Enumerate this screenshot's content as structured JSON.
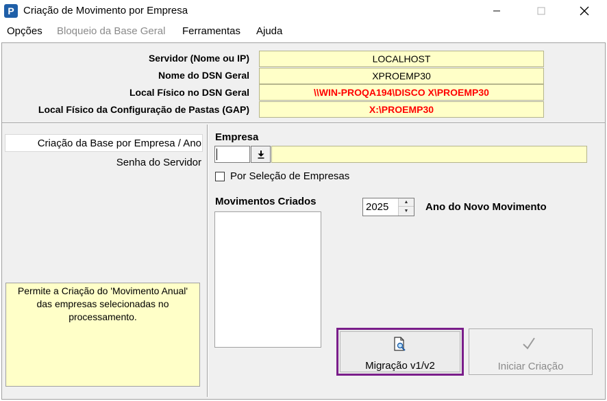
{
  "window": {
    "icon_letter": "P",
    "title": "Criação de Movimento por Empresa",
    "controls": [
      "minimize-icon",
      "maximize-icon",
      "close-icon"
    ]
  },
  "menu": {
    "items": [
      {
        "label": "Opções",
        "disabled": false
      },
      {
        "label": "Bloqueio da Base Geral",
        "disabled": true
      },
      {
        "label": "Ferramentas",
        "disabled": false
      },
      {
        "label": "Ajuda",
        "disabled": false
      }
    ]
  },
  "server_info": {
    "rows": [
      {
        "label": "Servidor (Nome ou IP)",
        "value": "LOCALHOST"
      },
      {
        "label": "Nome do DSN Geral",
        "value": "XPROEMP30"
      },
      {
        "label": "Local Físico no DSN Geral",
        "value": "\\\\WIN-PROQA194\\DISCO X\\PROEMP30"
      },
      {
        "label": "Local Físico da Configuração de Pastas (GAP)",
        "value": "X:\\PROEMP30"
      }
    ]
  },
  "left_nav": {
    "items": [
      "Criação da Base por Empresa / Ano",
      "Senha do Servidor"
    ],
    "hint": "Permite a Criação do 'Movimento Anual' das empresas selecionadas no processamento."
  },
  "empresa": {
    "label": "Empresa",
    "code_value": "",
    "name_value": ""
  },
  "selection_checkbox": {
    "label": "Por Seleção de Empresas",
    "checked": false
  },
  "movimentos": {
    "label": "Movimentos Criados",
    "items": []
  },
  "ano": {
    "value": "2025",
    "label": "Ano do Novo Movimento"
  },
  "buttons": {
    "migracao": "Migração v1/v2",
    "iniciar": "Iniciar Criação"
  },
  "colors": {
    "yellow_field": "#ffffc8",
    "red_text": "#ff0000",
    "highlight_border": "#7a1d8a",
    "app_icon": "#1f5fa8"
  }
}
